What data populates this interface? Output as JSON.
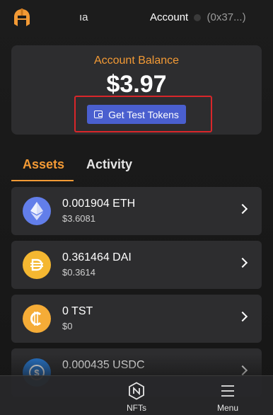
{
  "header": {
    "network_label": "ıa",
    "account_label": "Account",
    "account_address": "(0x37...)"
  },
  "balance": {
    "label": "Account Balance",
    "value": "$3.97",
    "get_tokens_label": "Get Test Tokens"
  },
  "tabs": [
    {
      "label": "Assets",
      "active": true
    },
    {
      "label": "Activity",
      "active": false
    }
  ],
  "assets": [
    {
      "amount": "0.001904 ETH",
      "value": "$3.6081",
      "icon": "eth-icon",
      "color": "#627eea"
    },
    {
      "amount": "0.361464 DAI",
      "value": "$0.3614",
      "icon": "dai-icon",
      "color": "#f4b731"
    },
    {
      "amount": "0 TST",
      "value": "$0",
      "icon": "tst-icon",
      "color": "#f5ac37"
    },
    {
      "amount": "0.000435 USDC",
      "value": "",
      "icon": "usdc-icon",
      "color": "#2775ca"
    }
  ],
  "nav": {
    "nfts_label": "NFTs",
    "menu_label": "Menu"
  },
  "colors": {
    "accent": "#f39a35",
    "button": "#4a5fcf",
    "highlight": "#d9262a",
    "card": "#2d2d2f"
  }
}
